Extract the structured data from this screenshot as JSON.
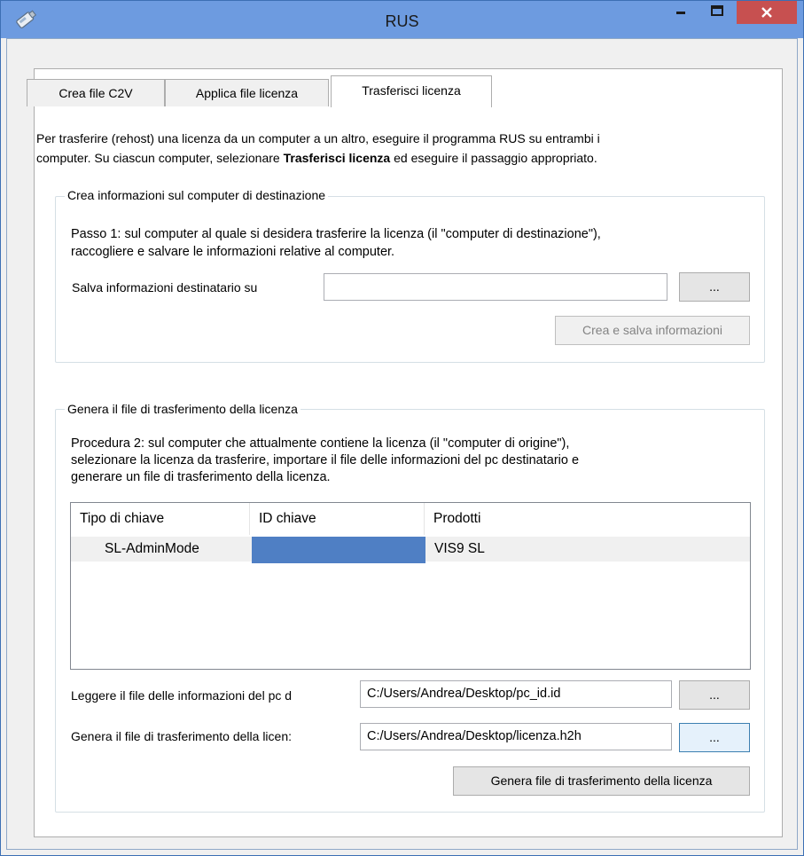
{
  "window": {
    "title": "RUS",
    "colors": {
      "titlebar": "#6d9be0",
      "close": "#c75050",
      "selection": "#4f7fc4"
    }
  },
  "tabs": [
    {
      "label": "Crea file C2V"
    },
    {
      "label": "Applica file licenza"
    },
    {
      "label": "Trasferisci licenza"
    }
  ],
  "intro": {
    "line1": "Per trasferire (rehost) una licenza da un computer a un altro, eseguire il programma RUS su entrambi i",
    "line2_before": "computer. Su ciascun computer, selezionare ",
    "line2_bold": "Trasferisci licenza",
    "line2_after": " ed eseguire il passaggio appropriato."
  },
  "step1": {
    "legend": "Crea informazioni sul computer di destinazione",
    "desc_line1": "Passo 1: sul computer al quale si desidera trasferire la licenza (il \"computer di destinazione\"),",
    "desc_line2": "raccogliere e salvare le informazioni relative al computer.",
    "save_label": "Salva informazioni destinatario su",
    "save_value": "",
    "browse_label": "...",
    "create_button": "Crea e salva informazioni"
  },
  "step2": {
    "legend": "Genera il file di trasferimento della licenza",
    "desc_line1": "Procedura 2: sul computer che attualmente contiene la licenza (il \"computer di origine\"),",
    "desc_line2": "selezionare la licenza da trasferire, importare il file delle informazioni del pc destinatario e",
    "desc_line3": "generare un file di trasferimento della licenza.",
    "columns": [
      "Tipo di chiave",
      "ID chiave",
      "Prodotti"
    ],
    "rows": [
      {
        "key_type": "SL-AdminMode",
        "key_id": "",
        "products": "VIS9 SL"
      }
    ],
    "read_label": "Leggere il file delle informazioni del pc d",
    "read_value": "C:/Users/Andrea/Desktop/pc_id.id",
    "gen_label": "Genera il file di trasferimento della licen:",
    "gen_value": "C:/Users/Andrea/Desktop/licenza.h2h",
    "browse_label": "...",
    "generate_button": "Genera file di trasferimento della licenza"
  }
}
